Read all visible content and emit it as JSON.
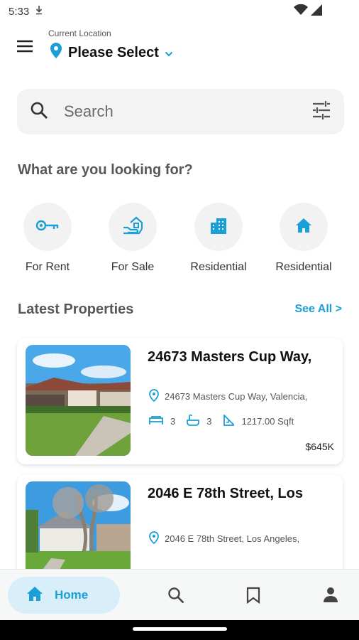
{
  "status_bar": {
    "time": "5:33"
  },
  "header": {
    "location_label": "Current Location",
    "location_value": "Please Select"
  },
  "search": {
    "placeholder": "Search"
  },
  "categories": {
    "title": "What are you looking for?",
    "items": [
      {
        "label": "For Rent",
        "icon": "key-icon"
      },
      {
        "label": "For Sale",
        "icon": "hand-house-icon"
      },
      {
        "label": "Residential",
        "icon": "building-icon"
      },
      {
        "label": "Residential",
        "icon": "home-icon"
      }
    ]
  },
  "latest": {
    "title": "Latest Properties",
    "see_all": "See All >",
    "properties": [
      {
        "title": "24673 Masters Cup Way,",
        "address": "24673 Masters Cup Way, Valencia,",
        "beds": "3",
        "baths": "3",
        "area": "1217.00 Sqft",
        "price": "$645K"
      },
      {
        "title": "2046 E 78th Street, Los",
        "address": "2046 E 78th Street, Los Angeles,"
      }
    ]
  },
  "bottom_nav": {
    "home_label": "Home",
    "items": [
      "home-icon",
      "search-icon",
      "bookmark-icon",
      "profile-icon"
    ]
  },
  "colors": {
    "accent": "#1a9fd6",
    "home_pill": "#d8eef8"
  }
}
